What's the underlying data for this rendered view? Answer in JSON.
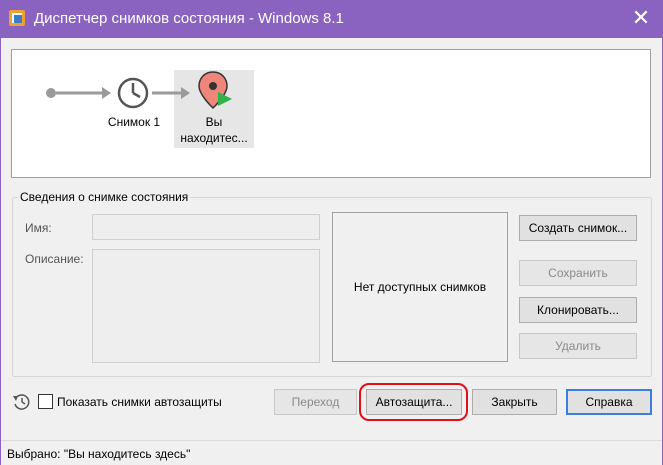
{
  "window": {
    "title": "Диспетчер снимков состояния - Windows 8.1",
    "close_glyph": "✕"
  },
  "tree": {
    "snapshot_label": "Снимок 1",
    "current_label_line1": "Вы",
    "current_label_line2": "находитес..."
  },
  "details": {
    "group_title": "Сведения о снимке состояния",
    "name_label": "Имя:",
    "name_value": "",
    "description_label": "Описание:",
    "description_value": "",
    "no_snapshots_text": "Нет доступных снимков"
  },
  "side_buttons": {
    "take_snapshot": "Создать снимок...",
    "save": "Сохранить",
    "clone": "Клонировать...",
    "delete": "Удалить"
  },
  "bottom": {
    "show_autoprotect_label": "Показать снимки автозащиты",
    "show_autoprotect_checked": false,
    "go_to": "Переход",
    "autoprotect": "Автозащита...",
    "close": "Закрыть",
    "help": "Справка"
  },
  "status": {
    "text": "Выбрано: \"Вы находитесь здесь\""
  },
  "colors": {
    "titlebar": "#8a62c0",
    "highlight": "#e0101a",
    "primary_border": "#3c7fd8"
  }
}
